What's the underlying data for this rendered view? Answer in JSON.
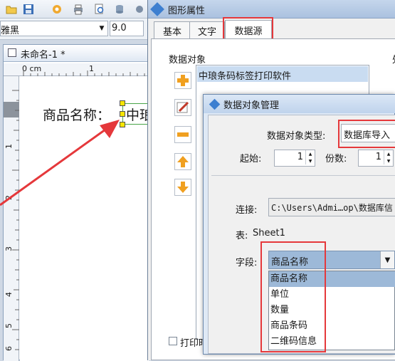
{
  "toolbar": {
    "font_name": "雅黑",
    "font_size": "9.0"
  },
  "document": {
    "tab_title": "未命名-1 *",
    "ruler_unit": "0 cm",
    "ruler_top_ticks": [
      "1"
    ],
    "ruler_left_ticks": [
      "1",
      "2",
      "3",
      "4",
      "5",
      "6"
    ],
    "label_text": "商品名称：",
    "field_text": "中琅"
  },
  "prop_dialog": {
    "title": "图形属性",
    "tabs": [
      {
        "label": "基本"
      },
      {
        "label": "文字"
      },
      {
        "label": "数据源"
      }
    ],
    "data_object_group": "数据对象",
    "data_object_item": "中琅条码标签打印软件",
    "right_group_fragment": "处",
    "print_time_save": "打印时保存"
  },
  "data_object_dialog": {
    "title": "数据对象管理",
    "type_label": "数据对象类型:",
    "type_value": "数据库导入",
    "start_label": "起始:",
    "start_value": "1",
    "copies_label": "份数:",
    "copies_value": "1",
    "connection_label": "连接:",
    "connection_value": "C:\\Users\\Admi…op\\数据库信",
    "table_label": "表:",
    "table_value": "Sheet1",
    "field_label": "字段:",
    "field_selected": "商品名称",
    "field_options": [
      "商品名称",
      "单位",
      "数量",
      "商品条码",
      "二维码信息"
    ]
  },
  "colors": {
    "accent": "#e5383b",
    "selection": "#9db9d8",
    "title_bar": "#bfd3ec"
  }
}
